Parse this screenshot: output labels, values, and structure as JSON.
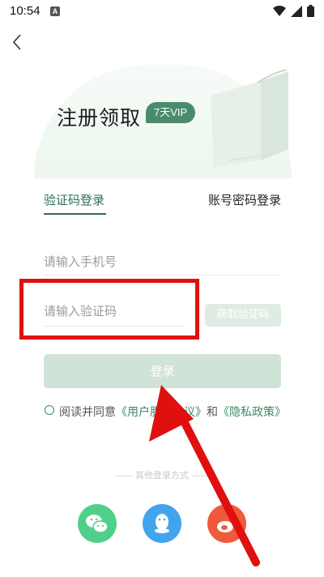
{
  "status_bar": {
    "time": "10:54",
    "notification_letter": "A"
  },
  "hero": {
    "title": "注册领取",
    "badge": "7天VIP"
  },
  "tabs": {
    "sms_login": "验证码登录",
    "password_login": "账号密码登录"
  },
  "form": {
    "phone_placeholder": "请输入手机号",
    "code_placeholder": "请输入验证码",
    "get_code_label": "获取验证码",
    "login_label": "登录"
  },
  "agreement": {
    "prefix": "阅读并同意",
    "user_agreement": "《用户服务协议》",
    "and": "和",
    "privacy_policy": "《隐私政策》"
  },
  "other_login": {
    "label": "—— 其他登录方式 ——"
  },
  "social": [
    "wechat-icon",
    "qq-icon",
    "weibo-icon"
  ],
  "colors": {
    "accent": "#2d6e52",
    "highlight": "#e01010"
  }
}
